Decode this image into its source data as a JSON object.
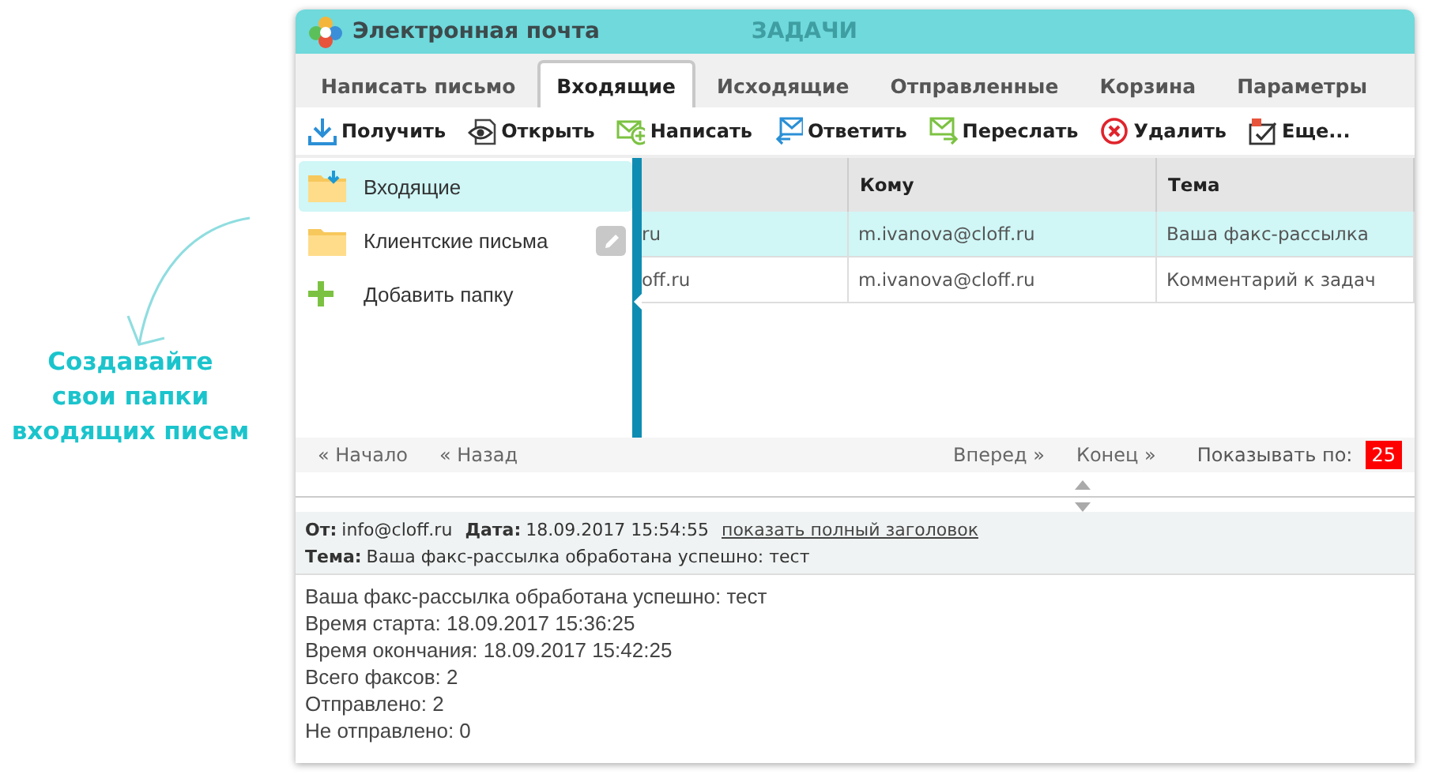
{
  "annotation": {
    "lines": [
      "Создавайте",
      "свои папки",
      "входящих писем"
    ]
  },
  "window": {
    "title": "Электронная почта",
    "watermark": "ЗАДАЧИ"
  },
  "tabs": [
    {
      "label": "Написать письмо",
      "selected": false
    },
    {
      "label": "Входящие",
      "selected": true
    },
    {
      "label": "Исходящие",
      "selected": false
    },
    {
      "label": "Отправленные",
      "selected": false
    },
    {
      "label": "Корзина",
      "selected": false
    },
    {
      "label": "Параметры",
      "selected": false
    }
  ],
  "toolbar": [
    {
      "label": "Получить",
      "kind": "download"
    },
    {
      "label": "Открыть",
      "kind": "eye"
    },
    {
      "label": "Написать",
      "kind": "compose"
    },
    {
      "label": "Ответить",
      "kind": "reply"
    },
    {
      "label": "Переслать",
      "kind": "forward"
    },
    {
      "label": "Удалить",
      "kind": "delete"
    },
    {
      "label": "Еще...",
      "kind": "more"
    }
  ],
  "folders": [
    {
      "label": "Входящие",
      "kind": "inbox",
      "selected": true,
      "edit_button": false
    },
    {
      "label": "Клиентские письма",
      "kind": "folder",
      "selected": false,
      "edit_button": true
    },
    {
      "label": "Добавить папку",
      "kind": "add",
      "selected": false,
      "edit_button": false
    }
  ],
  "table": {
    "columns": [
      "",
      "Кому",
      "Тема"
    ],
    "rows": [
      {
        "cells": [
          "ru",
          "m.ivanova@cloff.ru",
          "Ваша факс-рассылка"
        ],
        "selected": true
      },
      {
        "cells": [
          "off.ru",
          "m.ivanova@cloff.ru",
          "Комментарий к задач"
        ],
        "selected": false
      }
    ]
  },
  "pager": {
    "first": "« Начало",
    "prev": "« Назад",
    "next": "Вперед »",
    "last": "Конец »",
    "per_page_label": "Показывать по:",
    "per_page": "25"
  },
  "message": {
    "from_label": "От:",
    "from": "info@cloff.ru",
    "date_label": "Дата:",
    "date": "18.09.2017 15:54:55",
    "header_link": "показать полный заголовок",
    "subject_label": "Тема:",
    "subject": "Ваша факс-рассылка обработана успешно: тест",
    "body": [
      "Ваша факс-рассылка обработана успешно: тест",
      "Время старта: 18.09.2017 15:36:25",
      "Время окончания: 18.09.2017 15:42:25",
      "Всего факсов: 2",
      "Отправлено: 2",
      "Не отправлено: 0"
    ]
  }
}
